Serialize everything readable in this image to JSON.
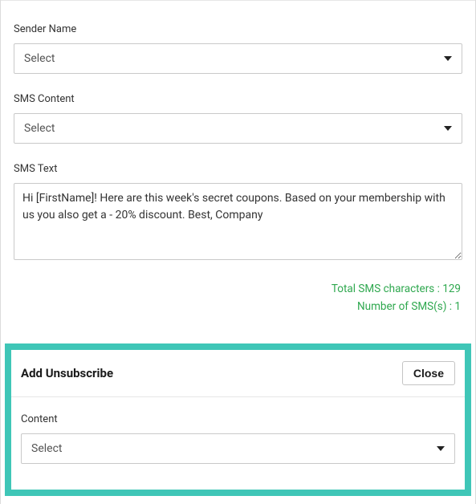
{
  "form": {
    "sender_name": {
      "label": "Sender Name",
      "selected": "Select"
    },
    "sms_content": {
      "label": "SMS Content",
      "selected": "Select"
    },
    "sms_text": {
      "label": "SMS Text",
      "value": "Hi [FirstName]! Here are this week's secret coupons. Based on your membership with us you also get a - 20% discount. Best, Company"
    },
    "stats": {
      "total_characters_label": "Total SMS characters :",
      "total_characters_value": "129",
      "number_sms_label": "Number of SMS(s) :",
      "number_sms_value": "1"
    }
  },
  "unsubscribe_panel": {
    "title": "Add Unsubscribe",
    "close_label": "Close",
    "content": {
      "label": "Content",
      "selected": "Select"
    }
  }
}
